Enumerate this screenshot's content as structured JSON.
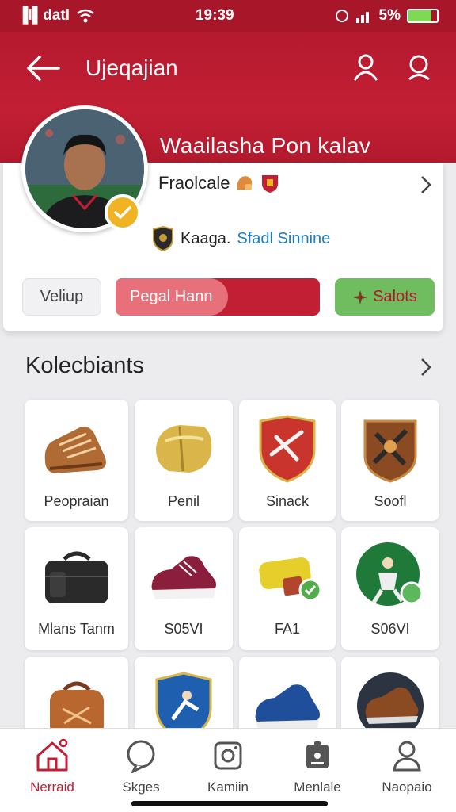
{
  "status_bar": {
    "carrier": "▐l▌datl",
    "time": "19:39",
    "battery": "5%"
  },
  "header": {
    "title": "Ujeqajian"
  },
  "profile": {
    "name": "Waailasha Pon kalav",
    "role": "Fraolcale",
    "club_label": "Kaaga.",
    "club_accent": "Sfadl Sinnine"
  },
  "actions": {
    "setup_label": "Veliup",
    "progress_label": "Pegal Hann",
    "progress_fraction": 0.55,
    "select_label": "Salots"
  },
  "collection": {
    "title": "Kolecbiants",
    "items": [
      {
        "label": "Peopraian",
        "icon": "leather-boot-icon"
      },
      {
        "label": "Penil",
        "icon": "golden-shin-guard-icon"
      },
      {
        "label": "Sinack",
        "icon": "red-crest-shield-icon"
      },
      {
        "label": "Soofl",
        "icon": "bronze-badge-icon"
      },
      {
        "label": "Mlans Tanm",
        "icon": "black-kit-bag-icon"
      },
      {
        "label": "S05VI",
        "icon": "pink-sneaker-icon"
      },
      {
        "label": "FA1",
        "icon": "gold-scroll-icon"
      },
      {
        "label": "S06VI",
        "icon": "green-player-badge-icon"
      },
      {
        "label": "",
        "icon": "brown-backpack-icon"
      },
      {
        "label": "",
        "icon": "blue-player-shield-icon"
      },
      {
        "label": "",
        "icon": "blue-sneaker-icon"
      },
      {
        "label": "",
        "icon": "brown-cleat-icon"
      }
    ]
  },
  "tabs": [
    {
      "label": "Nerraid",
      "icon": "home-icon",
      "active": true
    },
    {
      "label": "Skges",
      "icon": "chat-icon",
      "active": false
    },
    {
      "label": "Kamiin",
      "icon": "camera-icon",
      "active": false
    },
    {
      "label": "Menlale",
      "icon": "badge-icon",
      "active": false
    },
    {
      "label": "Naopaio",
      "icon": "profile-icon",
      "active": false
    }
  ],
  "colors": {
    "brand_red": "#c21f34",
    "success_green": "#6fbd5e",
    "badge_gold": "#f0b323",
    "accent_blue": "#1f7fbf"
  }
}
